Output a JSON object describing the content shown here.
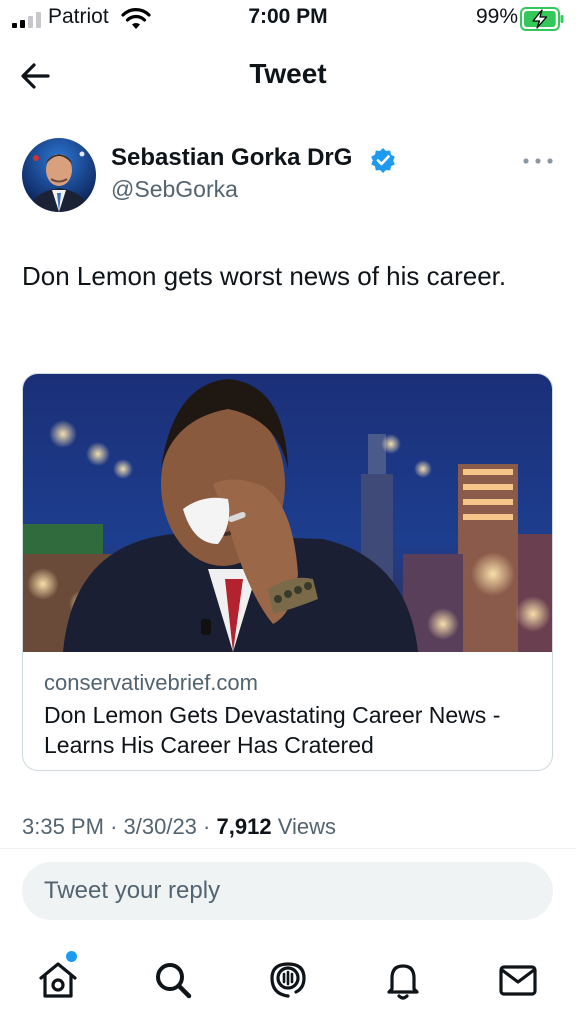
{
  "status_bar": {
    "carrier": "Patriot",
    "time": "7:00 PM",
    "battery_percent": "99%",
    "battery_level": 0.99
  },
  "header": {
    "title": "Tweet",
    "back_icon": "arrow-left-icon"
  },
  "tweet": {
    "author_name": "Sebastian Gorka DrG",
    "handle": "@SebGorka",
    "verified": true,
    "text": "Don Lemon gets worst news of his career.",
    "timestamp": "3:35 PM",
    "date": "3/30/23",
    "separator": "·",
    "views_count": "7,912",
    "views_label": "Views"
  },
  "card": {
    "domain": "conservativebrief.com",
    "title": "Don Lemon Gets Devastating Career News - Learns His Career Has Cratered"
  },
  "reply": {
    "placeholder": "Tweet your reply"
  },
  "tab_bar": {
    "items": [
      "home-icon",
      "search-icon",
      "spaces-icon",
      "notifications-icon",
      "messages-icon"
    ],
    "home_has_notification": true
  },
  "colors": {
    "accent": "#1d9bf0",
    "text": "#0f1419",
    "secondary": "#536471",
    "battery_green": "#34c759"
  }
}
